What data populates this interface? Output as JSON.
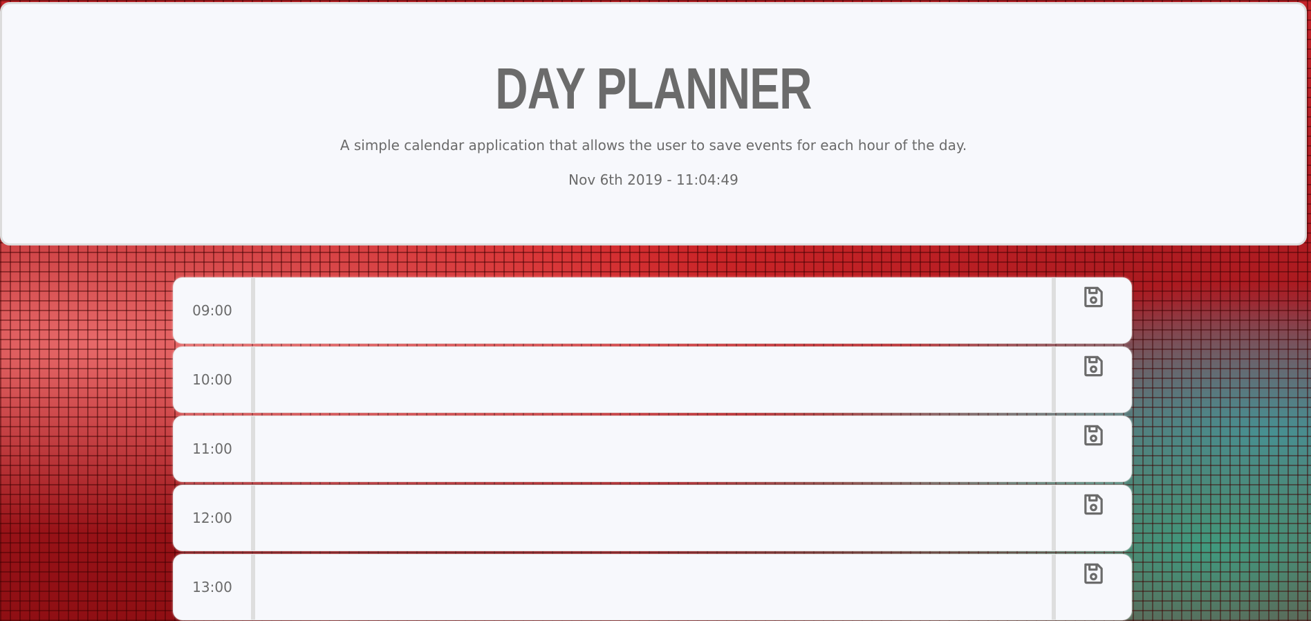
{
  "header": {
    "title": "DAY PLANNER",
    "lead": "A simple calendar application that allows the user to save events for each hour of the day.",
    "current_datetime": "Nov 6th 2019 - 11:04:49"
  },
  "hours": [
    {
      "time": "09:00",
      "event": ""
    },
    {
      "time": "10:00",
      "event": ""
    },
    {
      "time": "11:00",
      "event": ""
    },
    {
      "time": "12:00",
      "event": ""
    },
    {
      "time": "13:00",
      "event": ""
    }
  ],
  "save_icon": "floppy-disk-icon",
  "colors": {
    "panel": "#f7f8fc",
    "text": "#6a6a6a",
    "title": "#6b6b6b",
    "divider": "#dedede"
  }
}
